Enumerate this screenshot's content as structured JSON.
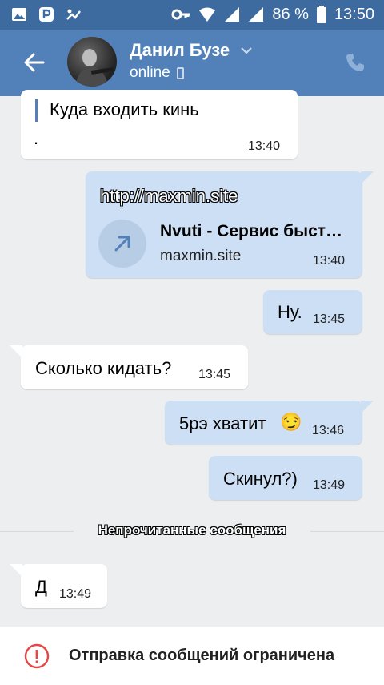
{
  "statusbar": {
    "battery": "86 %",
    "time": "13:50"
  },
  "header": {
    "name": "Данил Бузе",
    "status": "online"
  },
  "messages": [
    {
      "text": "Куда входить кинь",
      "extra": ".",
      "time": "13:40"
    },
    {
      "link_text": "http://maxmin.site",
      "card_title": "Nvuti - Сервис быст…",
      "card_domain": "maxmin.site",
      "time": "13:40"
    },
    {
      "text": "Ну.",
      "time": "13:45"
    },
    {
      "text": "Сколько кидать?",
      "time": "13:45"
    },
    {
      "text": "5рэ хватит",
      "emoji": "😏",
      "time": "13:46"
    },
    {
      "text": "Скинул?)",
      "time": "13:49"
    },
    {
      "text": "Д",
      "time": "13:49"
    }
  ],
  "divider": {
    "label": "Непрочитанные сообщения"
  },
  "bottom": {
    "text": "Отправка сообщений ограничена"
  }
}
